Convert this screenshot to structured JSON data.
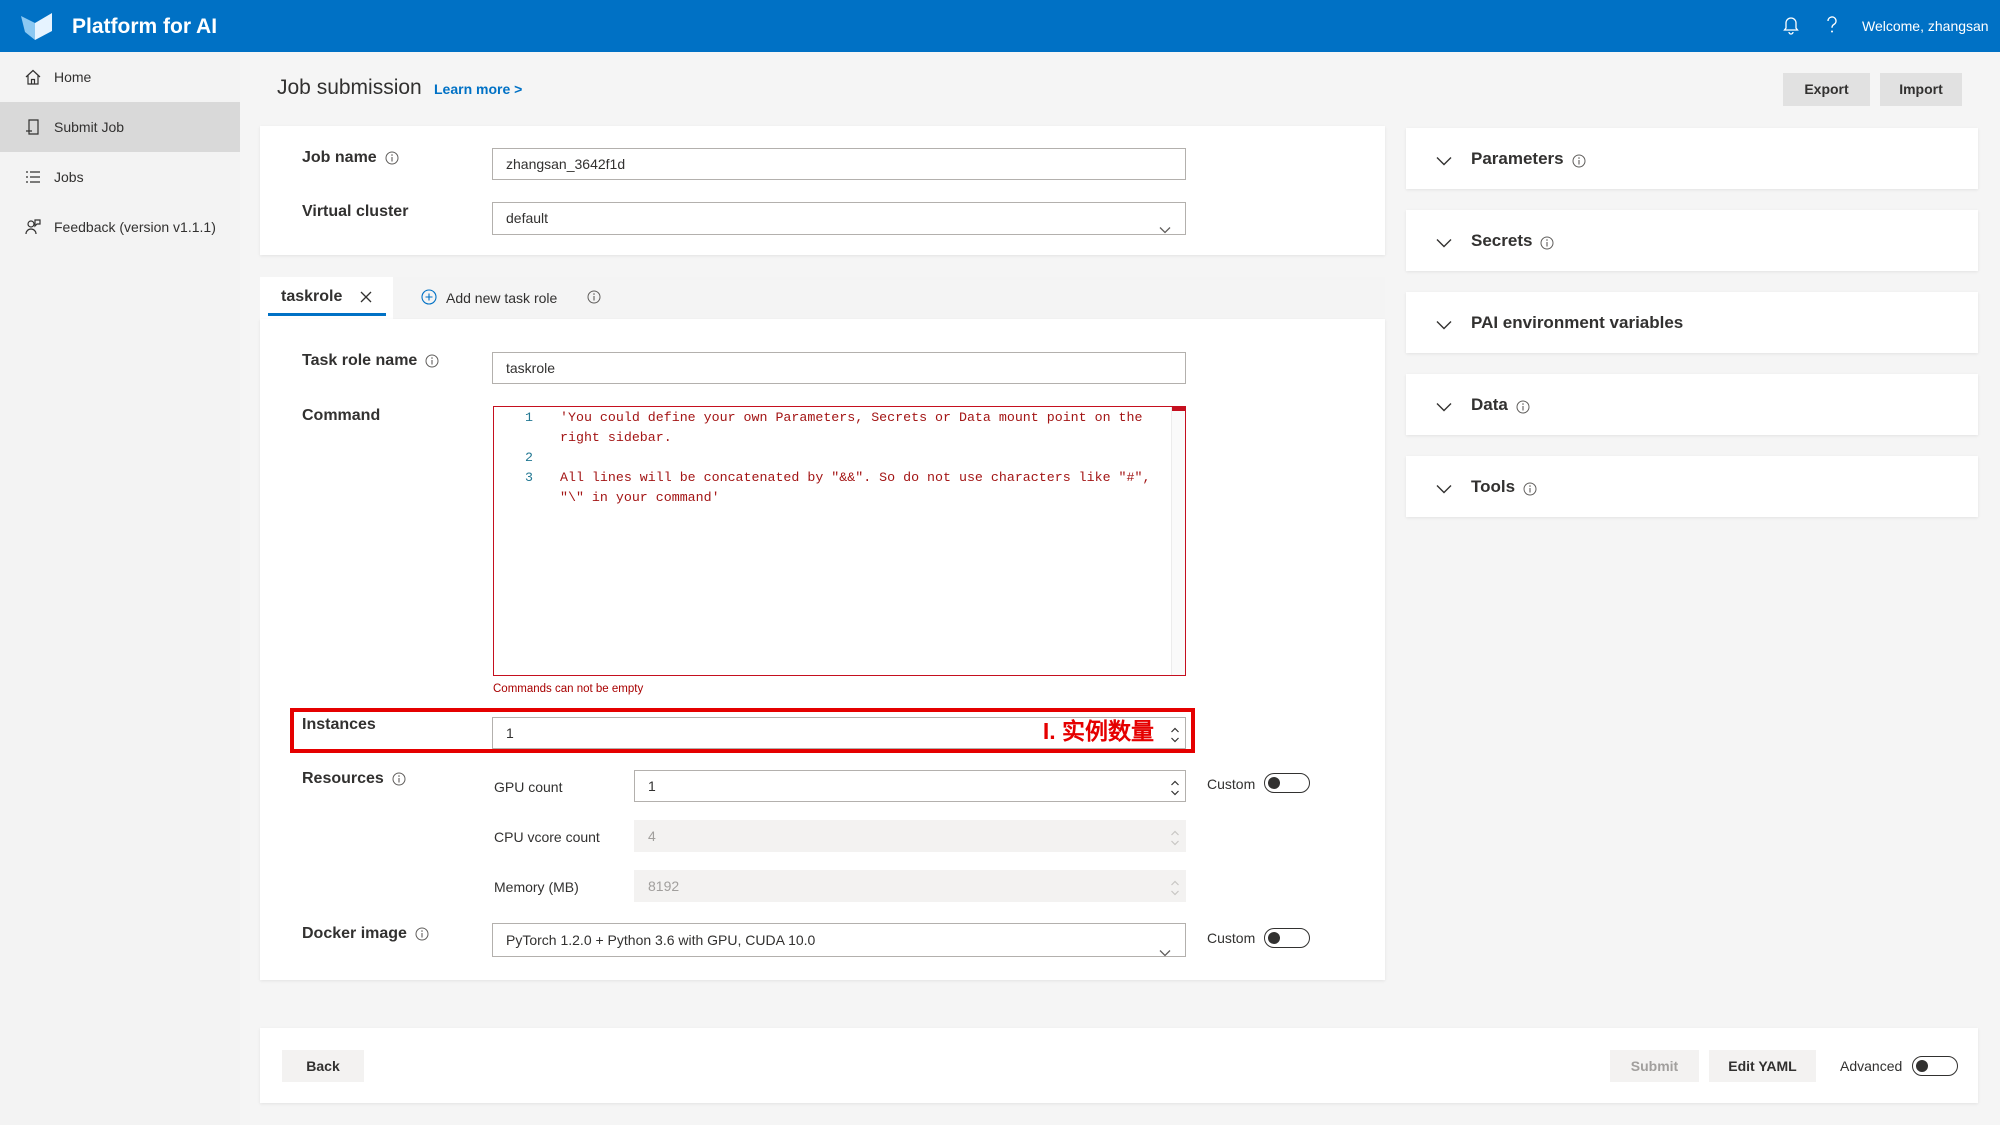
{
  "app": {
    "title": "Platform for AI",
    "welcome": "Welcome, zhangsan",
    "icons": {
      "logo": "platform-logo",
      "notifications": "bell-icon",
      "help": "help-icon"
    }
  },
  "sidebar": {
    "items": [
      {
        "label": "Home",
        "icon": "home-icon",
        "selected": false
      },
      {
        "label": "Submit Job",
        "icon": "submit-job-icon",
        "selected": true
      },
      {
        "label": "Jobs",
        "icon": "list-icon",
        "selected": false
      },
      {
        "label": "Feedback (version v1.1.1)",
        "icon": "feedback-icon",
        "selected": false
      }
    ]
  },
  "header": {
    "title": "Job submission",
    "learn_more": "Learn more >",
    "export_label": "Export",
    "import_label": "Import"
  },
  "job": {
    "name_label": "Job name",
    "name_value": "zhangsan_3642f1d",
    "cluster_label": "Virtual cluster",
    "cluster_value": "default"
  },
  "tabs": {
    "active_label": "taskrole",
    "add_label": "Add new task role"
  },
  "taskrole": {
    "name_label": "Task role name",
    "name_value": "taskrole",
    "command": {
      "label": "Command",
      "lines": [
        {
          "num": "1",
          "text": "'You could define your own Parameters, Secrets or Data mount point on the"
        },
        {
          "num": "",
          "text": "right sidebar."
        },
        {
          "num": "2",
          "text": ""
        },
        {
          "num": "3",
          "text": "All lines will be concatenated by \"&&\". So do not use characters like \"#\","
        },
        {
          "num": "",
          "text": "\"\\\" in your command'"
        }
      ],
      "error": "Commands can not be empty"
    },
    "instances": {
      "label": "Instances",
      "value": "1",
      "annotation": "I. 实例数量"
    },
    "resources": {
      "label": "Resources",
      "gpu_label": "GPU count",
      "gpu_value": "1",
      "cpu_label": "CPU vcore count",
      "cpu_value": "4",
      "memory_label": "Memory (MB)",
      "memory_value": "8192",
      "custom_label": "Custom",
      "custom_enabled": false
    },
    "docker": {
      "label": "Docker image",
      "value": "PyTorch 1.2.0 + Python 3.6 with GPU, CUDA 10.0",
      "custom_label": "Custom",
      "custom_enabled": false
    }
  },
  "right_panel": {
    "sections": [
      {
        "label": "Parameters",
        "has_info": true
      },
      {
        "label": "Secrets",
        "has_info": true
      },
      {
        "label": "PAI environment variables",
        "has_info": false
      },
      {
        "label": "Data",
        "has_info": true
      },
      {
        "label": "Tools",
        "has_info": true
      }
    ]
  },
  "footer": {
    "back_label": "Back",
    "submit_label": "Submit",
    "submit_enabled": false,
    "edit_yaml_label": "Edit YAML",
    "advanced_label": "Advanced",
    "advanced_enabled": false
  },
  "colors": {
    "topbar": "#0071c5",
    "accent": "#0071c5",
    "error": "#c50f1f",
    "annotation": "#e50000",
    "code_string": "#a31515",
    "line_number": "#237893"
  }
}
